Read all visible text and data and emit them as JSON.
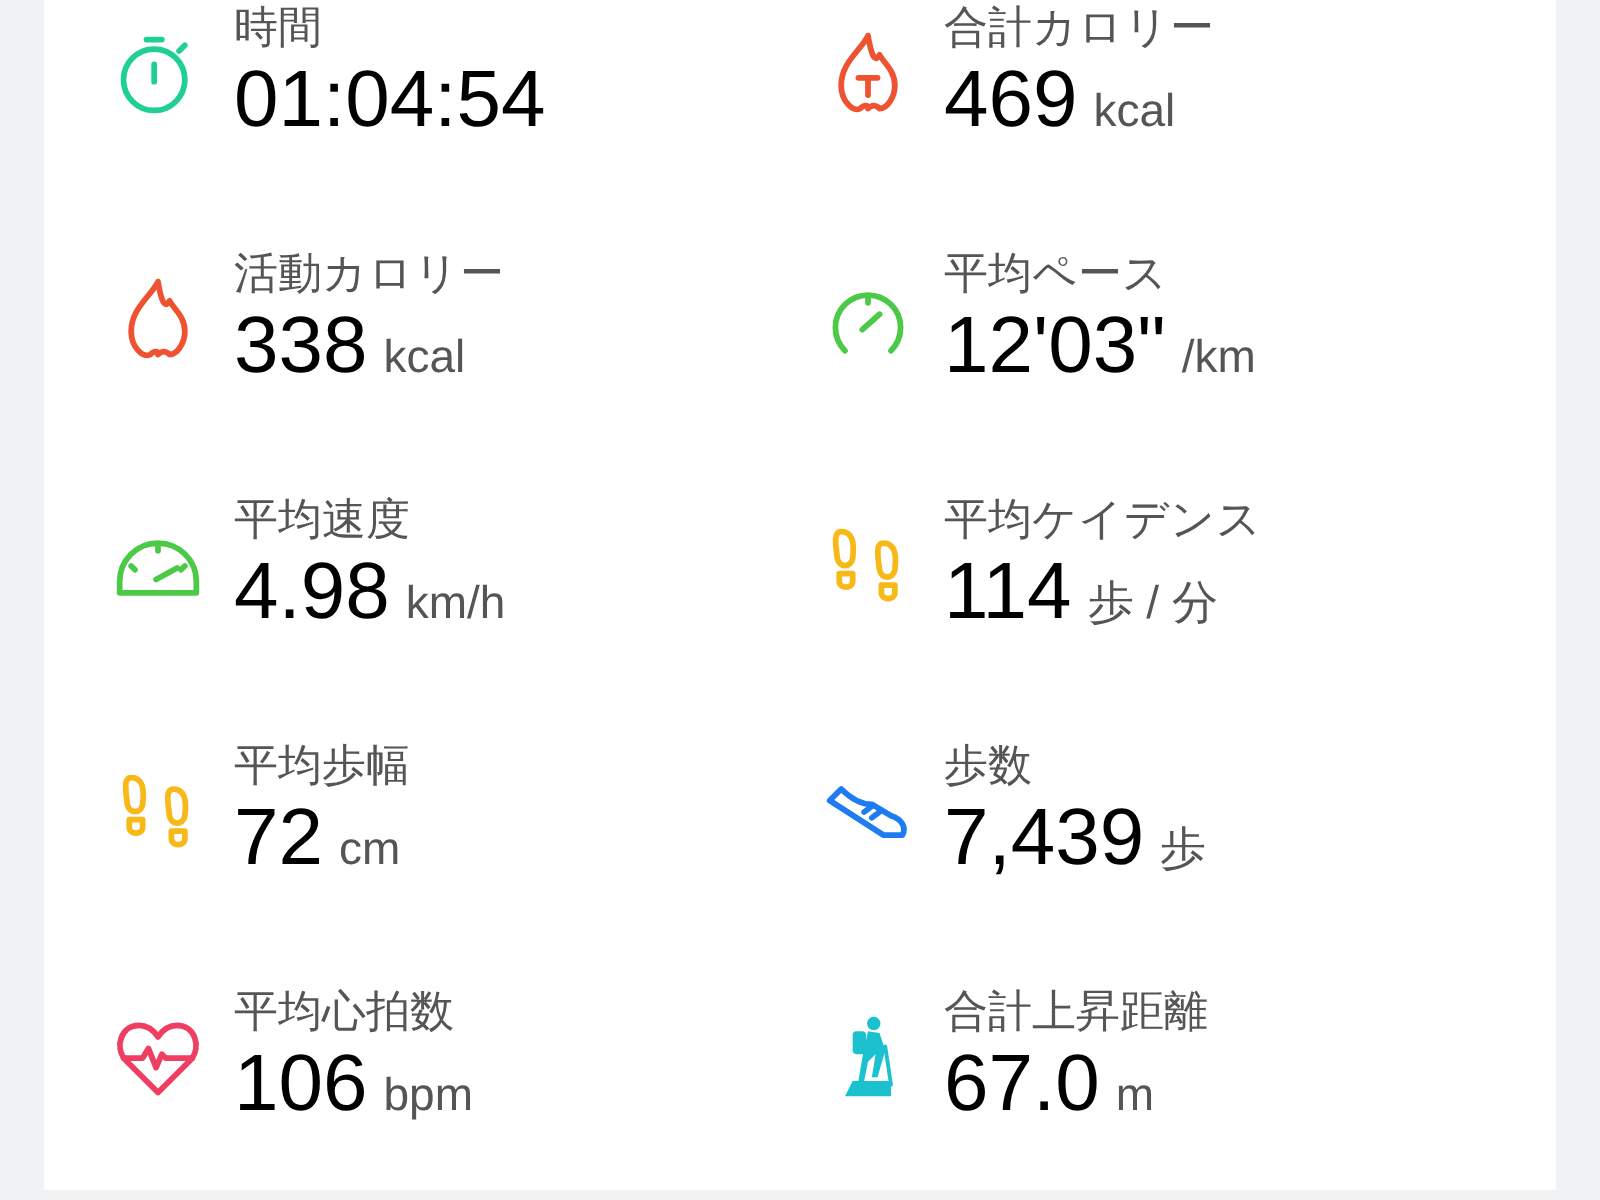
{
  "stats": [
    {
      "kind": "stopwatch",
      "label": "時間",
      "value": "01:04:54"
    },
    {
      "kind": "flametotal",
      "label": "合計カロリー",
      "value": "469",
      "unit": "kcal"
    },
    {
      "kind": "flame",
      "label": "活動カロリー",
      "value": "338",
      "unit": "kcal"
    },
    {
      "kind": "pace",
      "label": "平均ペース",
      "value": "12'03\"",
      "unit": "/km"
    },
    {
      "kind": "speed",
      "label": "平均速度",
      "value": "4.98",
      "unit": "km/h"
    },
    {
      "kind": "cadence",
      "label": "平均ケイデンス",
      "value": "114",
      "unit": "歩 / 分"
    },
    {
      "kind": "stride",
      "label": "平均歩幅",
      "value": "72",
      "unit": "cm"
    },
    {
      "kind": "steps",
      "label": "歩数",
      "value": "7,439",
      "unit": "歩"
    },
    {
      "kind": "heartrate",
      "label": "平均心拍数",
      "value": "106",
      "unit": "bpm"
    },
    {
      "kind": "ascent",
      "label": "合計上昇距離",
      "value": "67.0",
      "unit": "m"
    }
  ]
}
